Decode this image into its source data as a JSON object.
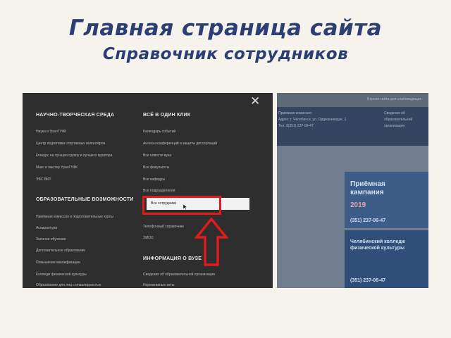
{
  "slide": {
    "title": "Главная страница сайта",
    "subtitle": "Справочник сотрудников"
  },
  "menu": {
    "sections": [
      {
        "label": "НАУЧНО-ТВОРЧЕСКАЯ СРЕДА",
        "items": [
          "Наука в УралГУФК",
          "Центр подготовки спортивных волонтёров",
          "Конкурс на лучшую группу и лучшего куратора",
          "Макс и мастер УралГУФК",
          "ЭБС ВКР"
        ]
      },
      {
        "label": "ОБРАЗОВАТЕЛЬНЫЕ ВОЗМОЖНОСТИ",
        "items": [
          "Приёмная комиссия и подготовительные курсы",
          "Аспирантура",
          "Заочное обучение",
          "Дополнительное образование",
          "Повышение квалификации",
          "Колледж физической культуры",
          "Образование для лиц с инвалидностью"
        ]
      },
      {
        "label": "ВСЁ В ОДИН КЛИК",
        "items": [
          "Календарь событий",
          "Анонсы конференций и защиты диссертаций",
          "Все новости вуза",
          "Все факультеты",
          "Все кафедры",
          "Все подразделения",
          "Все сотрудники",
          "Телефонный справочник",
          "ЭИОС"
        ]
      },
      {
        "label": "ИНФОРМАЦИЯ О ВУЗЕ",
        "items": [
          "Сведения об образовательной организации",
          "Нормативные акты"
        ]
      }
    ],
    "highlighted_item": "Все сотрудники",
    "close_label": "✕"
  },
  "site": {
    "top_text": "Версия сайта для слабовидящих",
    "info_left": [
      "Приёмная комиссия",
      "Адрес: г. Челябинск, ул. Орджоникидзе, 1",
      "Тел: 8(351) 237-06-47"
    ],
    "info_right": [
      "Сведения об",
      "образовательной",
      "организации"
    ],
    "banner1_title": "Приёмная кампания",
    "banner1_year": "2019",
    "banner1_phone": "(351) 237-06-47",
    "banner2_title": "Челябинский колледж физической культуры",
    "banner2_phone": "(351) 237-06-47"
  },
  "colors": {
    "accent": "#e01b1b",
    "title": "#2c3f74",
    "menu_bg": "#2e2e2e"
  }
}
